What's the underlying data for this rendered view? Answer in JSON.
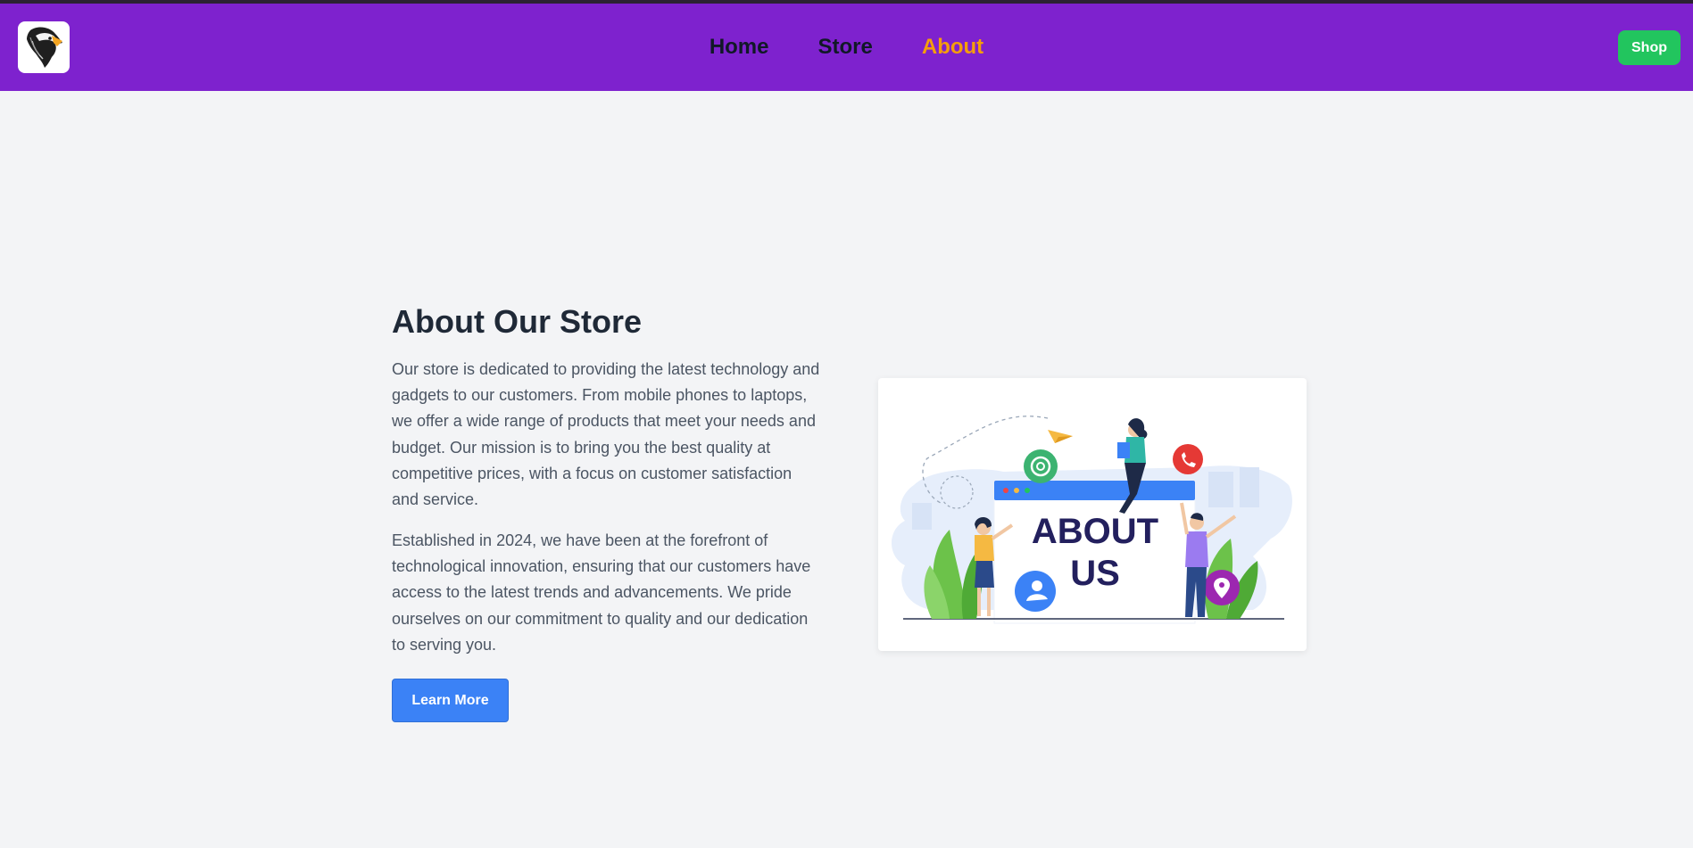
{
  "nav": {
    "links": [
      "Home",
      "Store",
      "About"
    ],
    "active": "About",
    "shop_label": "Shop"
  },
  "about": {
    "heading": "About Our Store",
    "paragraph1": "Our store is dedicated to providing the latest technology and gadgets to our customers. From mobile phones to laptops, we offer a wide range of products that meet your needs and budget. Our mission is to bring you the best quality at competitive prices, with a focus on customer satisfaction and service.",
    "paragraph2": "Established in 2024, we have been at the forefront of technological innovation, ensuring that our customers have access to the latest trends and advancements. We pride ourselves on our commitment to quality and our dedication to serving you.",
    "button_label": "Learn More"
  },
  "illustration": {
    "line1": "ABOUT",
    "line2": "US"
  },
  "colors": {
    "navbar": "#7e22ce",
    "active_link": "#f59e0b",
    "shop_button": "#22c55e",
    "learn_button": "#3b82f6",
    "background": "#f3f4f6"
  },
  "icons": [
    "eagle-logo-icon",
    "at-sign-icon",
    "phone-icon",
    "location-pin-icon",
    "user-icon",
    "paper-plane-icon"
  ]
}
